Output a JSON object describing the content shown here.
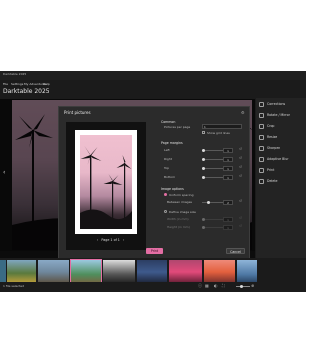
{
  "window": {
    "title": "Darktable 2025",
    "app_title": "Darktable 2025"
  },
  "menu": {
    "items": [
      "File",
      "Settings",
      "My Adventures",
      "Help"
    ]
  },
  "right_panel": {
    "items": [
      {
        "label": "Corrections",
        "icon": "corrections-icon"
      },
      {
        "label": "Rotate / Mirror",
        "icon": "rotate-icon"
      },
      {
        "label": "Crop",
        "icon": "crop-icon"
      },
      {
        "label": "Resize",
        "icon": "resize-icon"
      },
      {
        "label": "Sharpen",
        "icon": "sharpen-icon"
      },
      {
        "label": "Adaptive Blur",
        "icon": "blur-icon"
      },
      {
        "label": "Print",
        "icon": "print-icon"
      },
      {
        "label": "Delete",
        "icon": "trash-icon"
      }
    ]
  },
  "dialog": {
    "title": "Print pictures",
    "pager": {
      "prev": "‹",
      "label": "Page 1 of 1",
      "next": "›"
    },
    "common": {
      "heading": "Common",
      "pictures_per_page_label": "Pictures per page",
      "pictures_per_page_value": "1",
      "show_grid_label": "Show grid lines"
    },
    "margins": {
      "heading": "Page margins",
      "rows": [
        {
          "label": "Left",
          "value": "1"
        },
        {
          "label": "Right",
          "value": "1"
        },
        {
          "label": "Top",
          "value": "1"
        },
        {
          "label": "Bottom",
          "value": "1"
        }
      ]
    },
    "image_options": {
      "heading": "Image options",
      "uniform_label": "Uniform spacing",
      "between_label": "Between images",
      "between_value": "2",
      "define_label": "Define image size",
      "width_label": "Width (in mm)",
      "height_label": "Height (in mm)",
      "width_value": "1",
      "height_value": "1"
    },
    "buttons": {
      "print": "Print",
      "cancel": "Cancel"
    }
  },
  "status_bar": {
    "text": "1 file selected",
    "zoom": "100%"
  },
  "colors": {
    "accent": "#e46ea4",
    "background": "#1b1b1b",
    "panel": "#2b2b2b"
  }
}
